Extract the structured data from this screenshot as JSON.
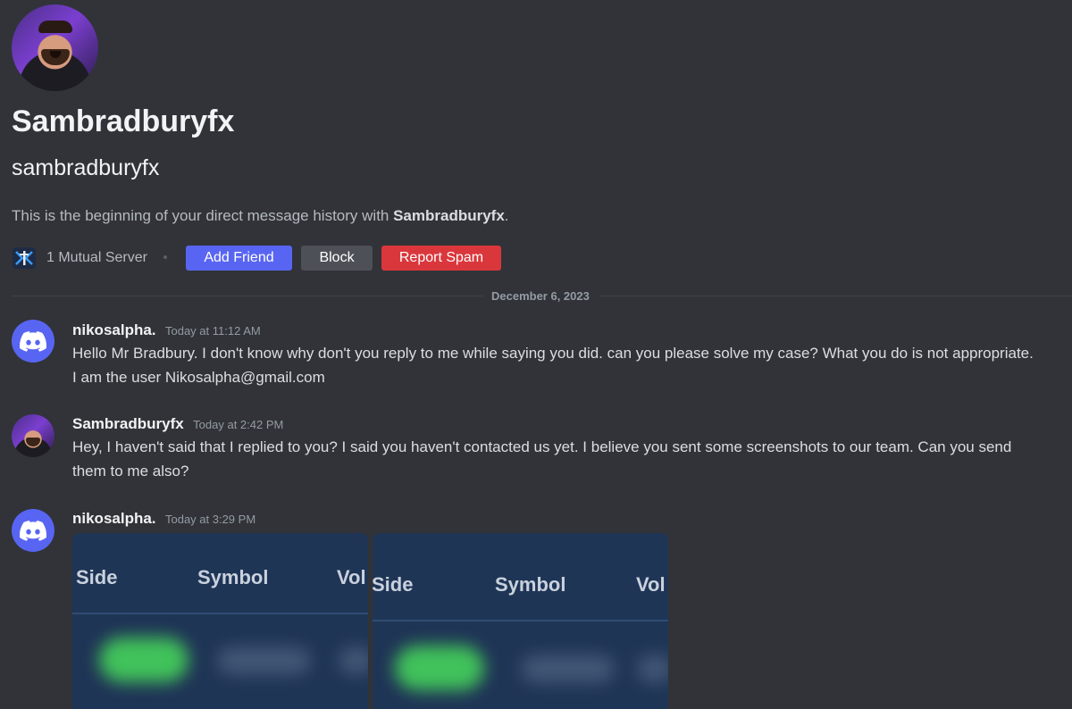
{
  "profile": {
    "display_name": "Sambradburyfx",
    "username": "sambradburyfx",
    "intro_prefix": "This is the beginning of your direct message history with ",
    "intro_name": "Sambradburyfx",
    "intro_suffix": ".",
    "mutual_servers": "1 Mutual Server",
    "add_friend_label": "Add Friend",
    "block_label": "Block",
    "report_spam_label": "Report Spam"
  },
  "divider_date": "December 6, 2023",
  "messages": [
    {
      "author": "nikosalpha.",
      "timestamp": "Today at 11:12 AM",
      "text": "Hello Mr Bradbury. I don't know why don't you reply to me while saying you did. can you please solve my case? What you do is not appropriate. I am the user Nikosalpha@gmail.com"
    },
    {
      "author": "Sambradburyfx",
      "timestamp": "Today at 2:42 PM",
      "text": "Hey, I haven't said that I replied to you? I said you haven't contacted us yet. I believe you sent some screenshots to our team. Can you send them to me also?"
    },
    {
      "author": "nikosalpha.",
      "timestamp": "Today at 3:29 PM",
      "attachments": [
        {
          "columns": [
            "Side",
            "Symbol",
            "Vol"
          ]
        },
        {
          "columns": [
            "Side",
            "Symbol",
            "Vol"
          ]
        }
      ]
    }
  ],
  "colors": {
    "background": "#313338",
    "blurple": "#5865f2",
    "danger": "#da373c",
    "secondary": "#4e5058"
  }
}
